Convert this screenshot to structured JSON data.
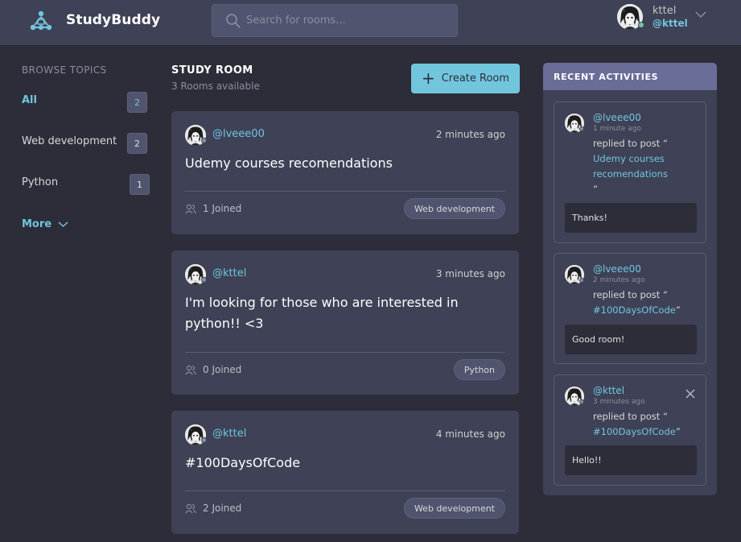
{
  "brand": "StudyBuddy",
  "search": {
    "placeholder": "Search for rooms..."
  },
  "user": {
    "name": "kttel",
    "handle": "@kttel"
  },
  "sidebar": {
    "title": "BROWSE TOPICS",
    "topics": [
      {
        "label": "All",
        "count": "2"
      },
      {
        "label": "Web development",
        "count": "2"
      },
      {
        "label": "Python",
        "count": "1"
      }
    ],
    "more_label": "More"
  },
  "main": {
    "title": "STUDY ROOM",
    "subtitle": "3 Rooms available",
    "create_label": "Create Room",
    "rooms": [
      {
        "author": "@lveee00",
        "time": "2 minutes ago",
        "title": "Udemy courses recomendations",
        "joined": "1 Joined",
        "topic": "Web development"
      },
      {
        "author": "@kttel",
        "time": "3 minutes ago",
        "title": "I'm looking for those who are interested in python!! <3",
        "joined": "0 Joined",
        "topic": "Python"
      },
      {
        "author": "@kttel",
        "time": "4 minutes ago",
        "title": "#100DaysOfCode",
        "joined": "2 Joined",
        "topic": "Web development"
      }
    ]
  },
  "activity": {
    "title": "RECENT ACTIVITIES",
    "items": [
      {
        "author": "@lveee00",
        "time": "1 minute ago",
        "prefix": "replied to post “",
        "post": "Udemy courses recomendations",
        "suffix": "”",
        "message": "Thanks!"
      },
      {
        "author": "@lveee00",
        "time": "2 minutes ago",
        "prefix": "replied to post “",
        "post": "#100DaysOfCode",
        "suffix": "”",
        "message": "Good room!"
      },
      {
        "author": "@kttel",
        "time": "3 minutes ago",
        "prefix": "replied to post “",
        "post": "#100DaysOfCode",
        "suffix": "”",
        "message": "Hello!!"
      }
    ]
  },
  "colors": {
    "accent": "#71c6dd",
    "background": "#2d2d39",
    "panel": "#3f4156",
    "activity_header": "#696d97"
  }
}
